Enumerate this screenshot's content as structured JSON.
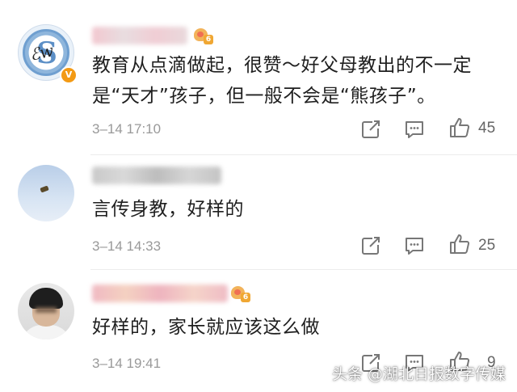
{
  "comments": [
    {
      "text_line1": "教育从点滴做起，很赞～好父母教出的不一定",
      "text_line2": "是“天才”孩子，但一般不会是“熊孩子”。",
      "time": "3–14 17:10",
      "likes": "45",
      "level": "6",
      "verified": "V"
    },
    {
      "text_line1": "言传身教，好样的",
      "time": "3–14 14:33",
      "likes": "25"
    },
    {
      "text_line1": "好样的，家长就应该这么做",
      "time": "3–14 19:41",
      "likes": "9",
      "level": "6"
    }
  ],
  "watermark": "头条 @湖北日报数字传媒",
  "icons": [
    "share-icon",
    "comment-icon",
    "like-icon"
  ],
  "colors": {
    "verified": "#f39a14",
    "muted": "#999999",
    "text": "#1f1f1f"
  }
}
